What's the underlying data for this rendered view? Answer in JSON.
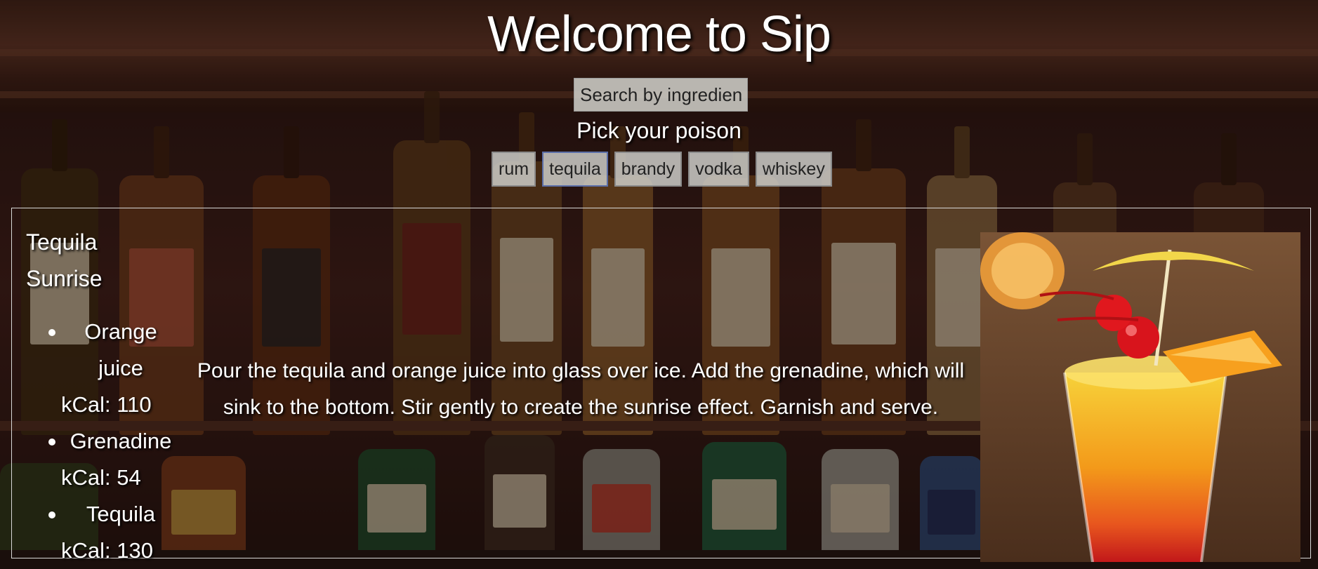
{
  "header": {
    "title": "Welcome to Sip",
    "search_placeholder": "Search by ingredient",
    "pick_label": "Pick your poison"
  },
  "spirits": [
    {
      "label": "rum",
      "active": false
    },
    {
      "label": "tequila",
      "active": true
    },
    {
      "label": "brandy",
      "active": false
    },
    {
      "label": "vodka",
      "active": false
    },
    {
      "label": "whiskey",
      "active": false
    }
  ],
  "drink": {
    "name": "Tequila Sunrise",
    "ingredients": [
      {
        "name": "Orange juice",
        "kcal": "kCal: 110"
      },
      {
        "name": "Grenadine",
        "kcal": "kCal: 54"
      },
      {
        "name": "Tequila",
        "kcal": "kCal: 130"
      }
    ],
    "instructions": "Pour the tequila and orange juice into glass over ice. Add the grenadine, which will sink to the bottom. Stir gently to create the sunrise effect. Garnish and serve."
  },
  "colors": {
    "accent_border": "#5b6ea8",
    "button_bg": "#cdcdc8"
  }
}
